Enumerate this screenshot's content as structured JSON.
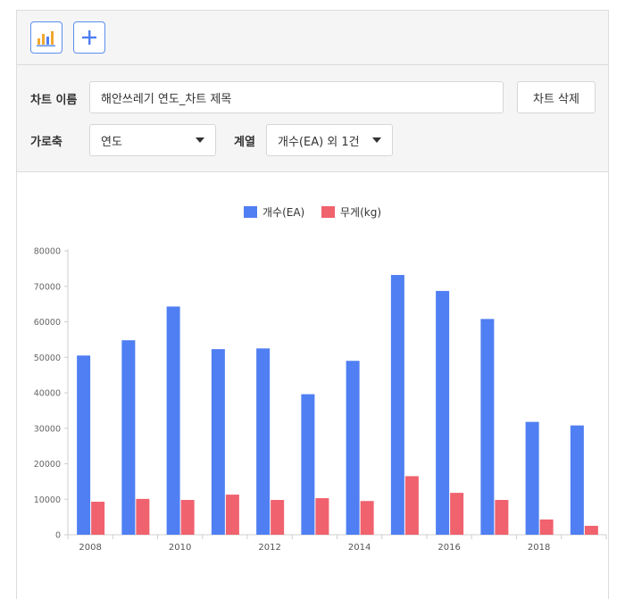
{
  "toolbar": {
    "chart_icon": "bar-chart-icon",
    "add_icon": "plus-icon"
  },
  "settings": {
    "chart_name_label": "차트 이름",
    "chart_name_value": "해안쓰레기 연도_차트 제목",
    "delete_button": "차트 삭제",
    "x_axis_label": "가로축",
    "x_axis_value": "연도",
    "series_label": "계열",
    "series_value": "개수(EA) 외 1건"
  },
  "colors": {
    "accent": "#5b8def",
    "series1": "#4f7ff2",
    "series2": "#f0626e"
  },
  "chart_data": {
    "type": "bar",
    "categories": [
      "2008",
      "2009",
      "2010",
      "2011",
      "2012",
      "2013",
      "2014",
      "2015",
      "2016",
      "2017",
      "2018",
      "2019"
    ],
    "tick_labels": [
      "2008",
      "",
      "2010",
      "",
      "2012",
      "",
      "2014",
      "",
      "2016",
      "",
      "2018",
      ""
    ],
    "series": [
      {
        "name": "개수(EA)",
        "values": [
          50500,
          54800,
          64300,
          52300,
          52500,
          39600,
          49000,
          73200,
          68700,
          60800,
          31800,
          30800
        ]
      },
      {
        "name": "무게(kg)",
        "values": [
          9300,
          10100,
          9800,
          11300,
          9800,
          10300,
          9500,
          16500,
          11800,
          9800,
          4300,
          2500
        ]
      }
    ],
    "ylim": [
      0,
      80000
    ],
    "yticks": [
      "0",
      "10000",
      "20000",
      "30000",
      "40000",
      "50000",
      "60000",
      "70000",
      "80000"
    ],
    "legend": "top-center",
    "grid": false
  }
}
